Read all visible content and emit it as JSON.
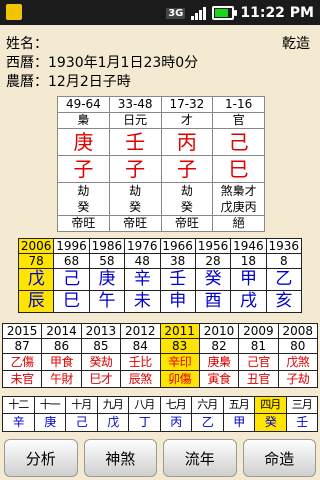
{
  "statusbar": {
    "time": "11:22 PM",
    "network": "3G"
  },
  "info": {
    "name_label": "姓名：",
    "gender": "乾造",
    "solar_label": "西曆：",
    "solar_value": "1930年1月1日23時0分",
    "lunar_label": "農曆：",
    "lunar_value": "12月2日子時"
  },
  "pillars": [
    {
      "age": "49-64",
      "star": "梟",
      "stem": "庚",
      "branch": "子",
      "hidden": [
        "劫",
        "癸"
      ],
      "phase": "帝旺"
    },
    {
      "age": "33-48",
      "star": "日元",
      "stem": "壬",
      "branch": "子",
      "hidden": [
        "劫",
        "癸"
      ],
      "phase": "帝旺"
    },
    {
      "age": "17-32",
      "star": "才",
      "stem": "丙",
      "branch": "子",
      "hidden": [
        "劫",
        "癸"
      ],
      "phase": "帝旺"
    },
    {
      "age": "1-16",
      "star": "官",
      "stem": "己",
      "branch": "巳",
      "hidden": [
        "煞梟才",
        "戊庚丙"
      ],
      "phase": "絕"
    }
  ],
  "dayun": [
    {
      "year": "2006",
      "age": "78",
      "stem": "戊",
      "branch": "辰",
      "highlight": true
    },
    {
      "year": "1996",
      "age": "68",
      "stem": "己",
      "branch": "巳",
      "highlight": false
    },
    {
      "year": "1986",
      "age": "58",
      "stem": "庚",
      "branch": "午",
      "highlight": false
    },
    {
      "year": "1976",
      "age": "48",
      "stem": "辛",
      "branch": "未",
      "highlight": false
    },
    {
      "year": "1966",
      "age": "38",
      "stem": "壬",
      "branch": "申",
      "highlight": false
    },
    {
      "year": "1956",
      "age": "28",
      "stem": "癸",
      "branch": "酉",
      "highlight": false
    },
    {
      "year": "1946",
      "age": "18",
      "stem": "甲",
      "branch": "戌",
      "highlight": false
    },
    {
      "year": "1936",
      "age": "8",
      "stem": "乙",
      "branch": "亥",
      "highlight": false
    }
  ],
  "liunian": [
    {
      "year": "2015",
      "age": "87",
      "top": "乙傷",
      "bottom": "未官",
      "highlight": false
    },
    {
      "year": "2014",
      "age": "86",
      "top": "甲食",
      "bottom": "午財",
      "highlight": false
    },
    {
      "year": "2013",
      "age": "85",
      "top": "癸劫",
      "bottom": "巳才",
      "highlight": false
    },
    {
      "year": "2012",
      "age": "84",
      "top": "壬比",
      "bottom": "辰煞",
      "highlight": false
    },
    {
      "year": "2011",
      "age": "83",
      "top": "辛印",
      "bottom": "卯傷",
      "highlight": true
    },
    {
      "year": "2010",
      "age": "82",
      "top": "庚梟",
      "bottom": "寅食",
      "highlight": false
    },
    {
      "year": "2009",
      "age": "81",
      "top": "己官",
      "bottom": "丑官",
      "highlight": false
    },
    {
      "year": "2008",
      "age": "80",
      "top": "戊煞",
      "bottom": "子劫",
      "highlight": false
    }
  ],
  "months": [
    {
      "label": "十二",
      "stem": "辛",
      "highlight": false
    },
    {
      "label": "十一",
      "stem": "庚",
      "highlight": false
    },
    {
      "label": "十月",
      "stem": "己",
      "highlight": false
    },
    {
      "label": "九月",
      "stem": "戊",
      "highlight": false
    },
    {
      "label": "八月",
      "stem": "丁",
      "highlight": false
    },
    {
      "label": "七月",
      "stem": "丙",
      "highlight": false
    },
    {
      "label": "六月",
      "stem": "乙",
      "highlight": false
    },
    {
      "label": "五月",
      "stem": "甲",
      "highlight": false
    },
    {
      "label": "四月",
      "stem": "癸",
      "highlight": true
    },
    {
      "label": "三月",
      "stem": "壬",
      "highlight": false
    }
  ],
  "buttons": {
    "analysis": "分析",
    "shensha": "神煞",
    "liunian": "流年",
    "mingzao": "命造"
  },
  "colors": {
    "background": "#f4ead2",
    "stem_red": "#e00000",
    "branch_blue": "#0000cc",
    "highlight": "#ffe400"
  }
}
